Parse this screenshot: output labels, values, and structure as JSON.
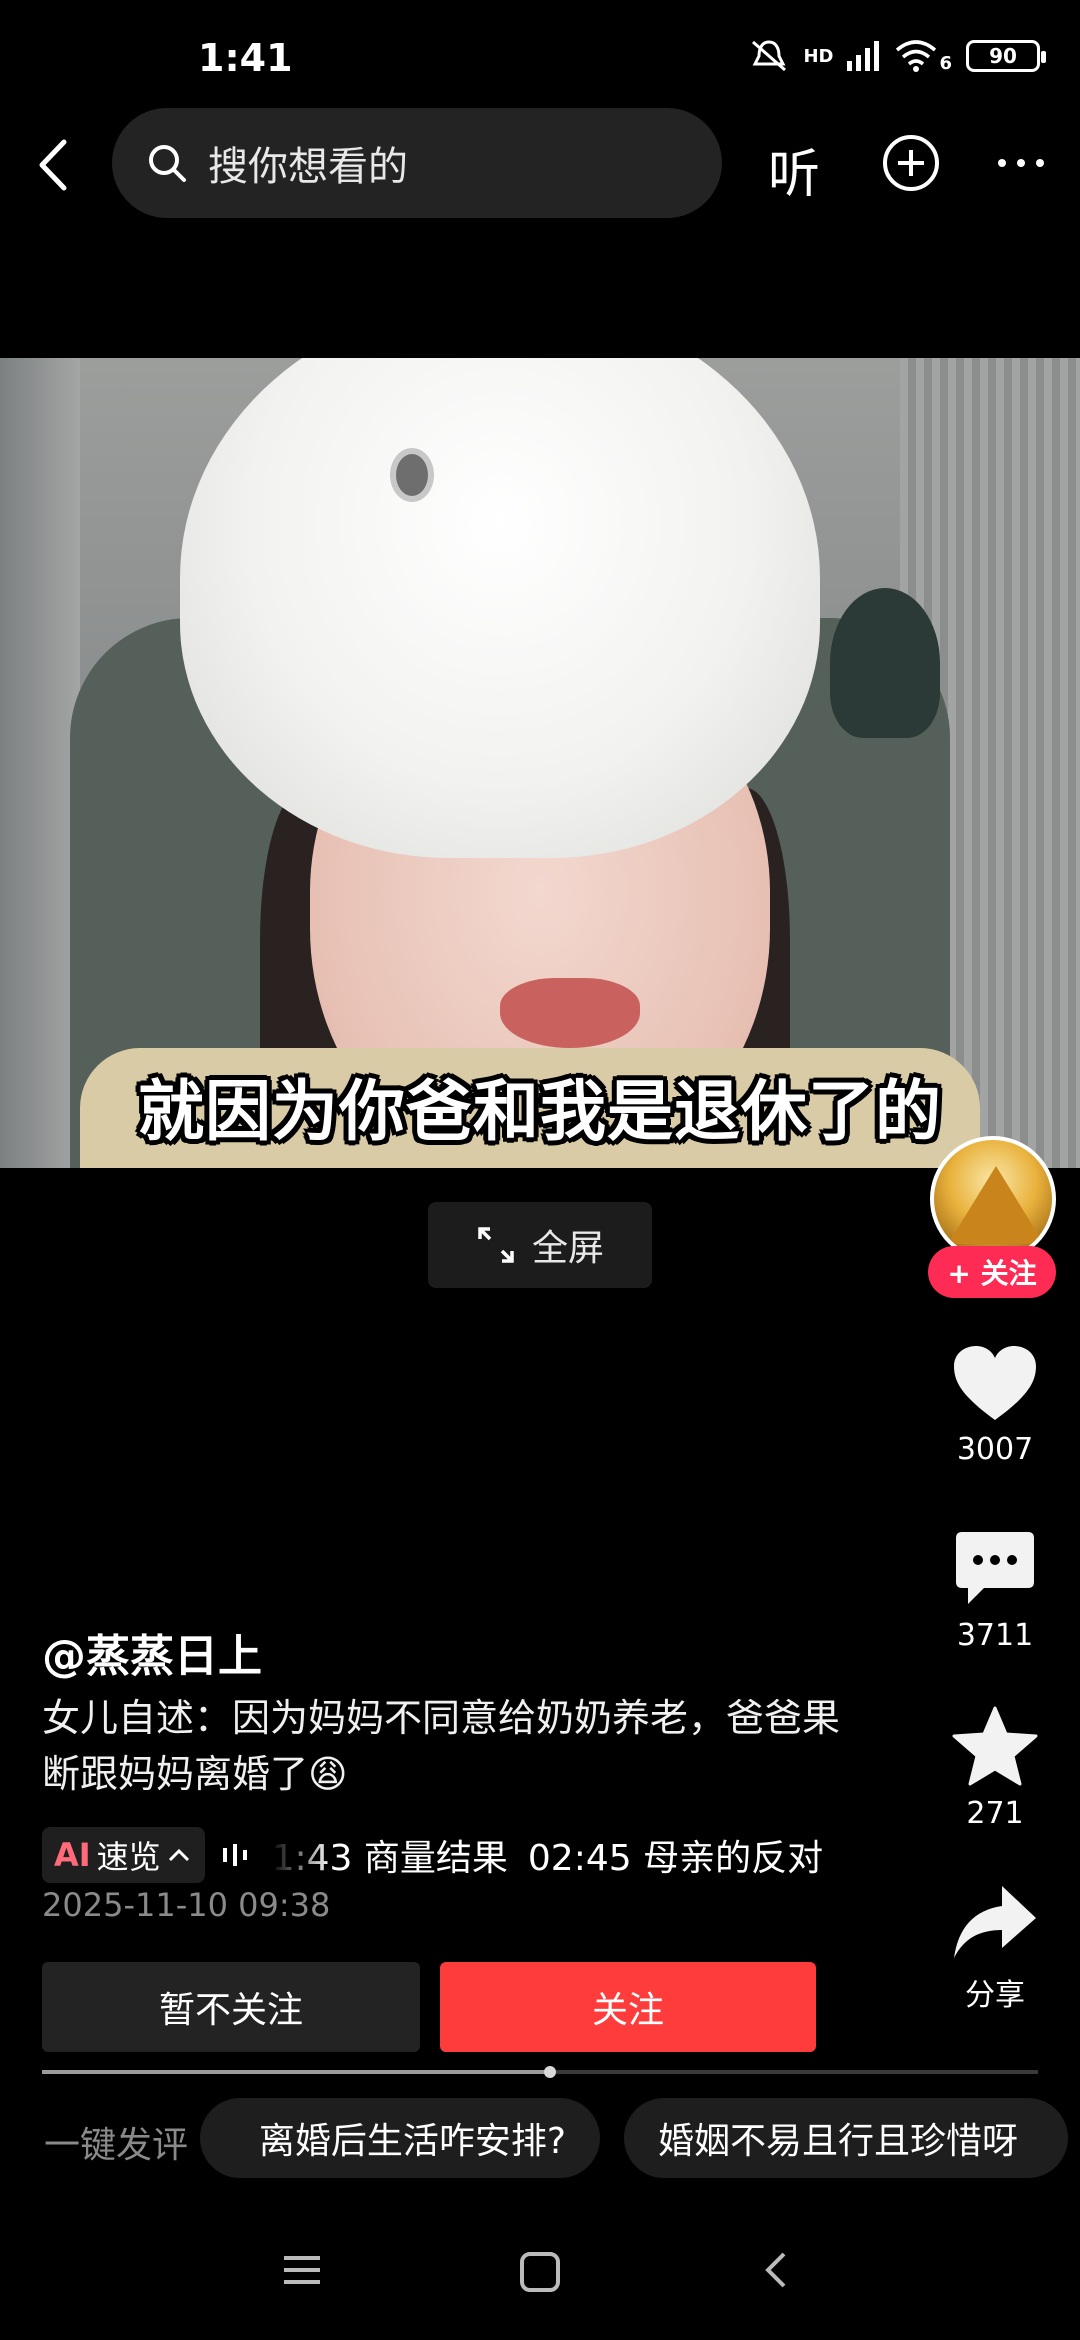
{
  "status_bar": {
    "time": "1:41",
    "battery": "90",
    "network_label": "HD",
    "wifi_label": "6"
  },
  "header": {
    "search_placeholder": "搜你想看的",
    "listen_label": "听"
  },
  "video": {
    "caption": "就因为你爸和我是退休了的",
    "fullscreen_label": "全屏"
  },
  "rail": {
    "follow_label": "+ 关注",
    "likes": "3007",
    "comments": "3711",
    "favorites": "271",
    "share_label": "分享"
  },
  "post": {
    "author": "@蒸蒸日上",
    "description": "女儿自述：因为妈妈不同意给奶奶养老，爸爸果断跟妈妈离婚了😩",
    "ai_badge": "AI",
    "ai_label": "速览",
    "chapters": [
      "01:43 商量结果",
      "02:45 母亲的反对"
    ],
    "date": "2025-11-10 09:38"
  },
  "actions": {
    "unfollow_label": "暂不关注",
    "follow_label": "关注"
  },
  "progress": {
    "fraction": 0.51
  },
  "quick_comments": {
    "label": "一键发评",
    "chips": [
      "离婚后生活咋安排?",
      "婚姻不易且行且珍惜呀"
    ]
  },
  "colors": {
    "accent": "#fe2c55",
    "follow_button": "#fe3c3c",
    "background": "#000000"
  },
  "icons": [
    "back-icon",
    "search-icon",
    "add-icon",
    "more-icon",
    "expand-icon",
    "heart-icon",
    "comment-icon",
    "star-icon",
    "share-icon",
    "menu-icon",
    "home-icon",
    "nav-back-icon"
  ]
}
